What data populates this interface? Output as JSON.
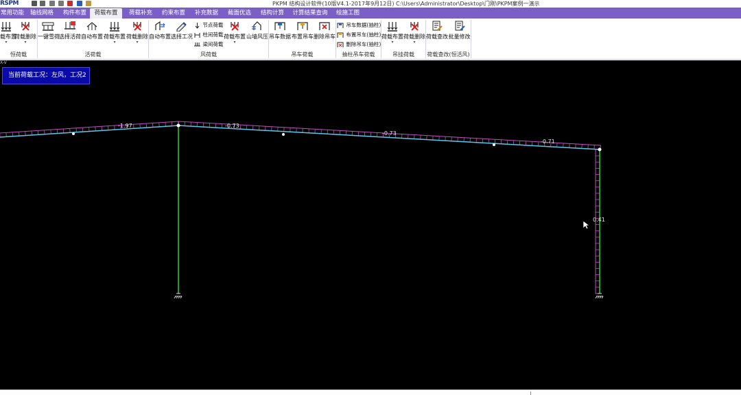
{
  "app": {
    "title": "PKPM 结构设计软件(10版V4.1-2017年9月12日) C:\\Users\\Administrator\\Desktop\\门刚\\PKPM案例一演示",
    "logo": "RSPM"
  },
  "tabs": [
    {
      "label": "常用功能"
    },
    {
      "label": "轴线网格"
    },
    {
      "label": "构件布置"
    },
    {
      "label": "荷载布置",
      "active": true
    },
    {
      "label": "荷载补充"
    },
    {
      "label": "约束布置"
    },
    {
      "label": "补充数据"
    },
    {
      "label": "截面优选"
    },
    {
      "label": "结构计算"
    },
    {
      "label": "计算结果查询"
    },
    {
      "label": "绘施工图"
    }
  ],
  "ribbon": {
    "groups": [
      {
        "name": "恒荷载"
      },
      {
        "name": "活荷载"
      },
      {
        "name": "风荷载"
      },
      {
        "name": "吊车荷载"
      },
      {
        "name": "抽柱吊车荷载"
      },
      {
        "name": "吊挂荷载"
      },
      {
        "name": "荷载查改(恒活风)"
      }
    ],
    "buttons": {
      "dead_place": "载布置",
      "dead_delete": "荷载删除",
      "live_one_key": "一键雪荷",
      "live_select": "选择活荷",
      "live_auto": "自动布置",
      "live_place": "荷载布置",
      "live_delete": "荷载删除",
      "wind_auto": "自动布置",
      "wind_select_case": "选择工况",
      "wind_node_load": "节点荷载",
      "wind_column_load": "柱间荷载",
      "wind_beam_load": "梁间荷载",
      "wind_place": "荷载布置",
      "wind_delete": "荷载删除",
      "wind_gable": "山墙风压",
      "crane_data": "吊车数据",
      "crane_place": "布置吊车",
      "crane_delete": "删除吊车",
      "sub_crane_data": "吊车数据(抽柱)",
      "sub_crane_place": "布置吊车(抽柱)",
      "sub_crane_delete": "删除吊车(抽柱)",
      "hang_place": "荷载布置",
      "hang_delete": "荷载删除",
      "modify_load": "荷载查改",
      "batch_modify": "批量修改"
    }
  },
  "viewport": {
    "view_label": "X-V",
    "status_text": "当前荷载工况：左风，工况2",
    "load_values": [
      "-1.97",
      "-0.73",
      "-0.73",
      "-0.71",
      "0.41"
    ]
  },
  "colors": {
    "tab_bar": "#7a5fc6",
    "canvas": "#000000",
    "load_hatch": "#c050c0",
    "beam": "#59c8e8",
    "column": "#33cc33",
    "status_box": "#0a0aa8"
  }
}
